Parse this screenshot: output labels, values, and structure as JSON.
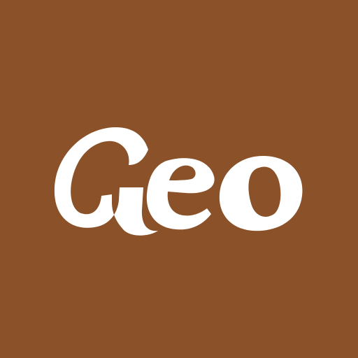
{
  "app_icon": {
    "logo_text": "Geo",
    "background_color": "#8B5229",
    "text_color": "#FFFFFF"
  }
}
